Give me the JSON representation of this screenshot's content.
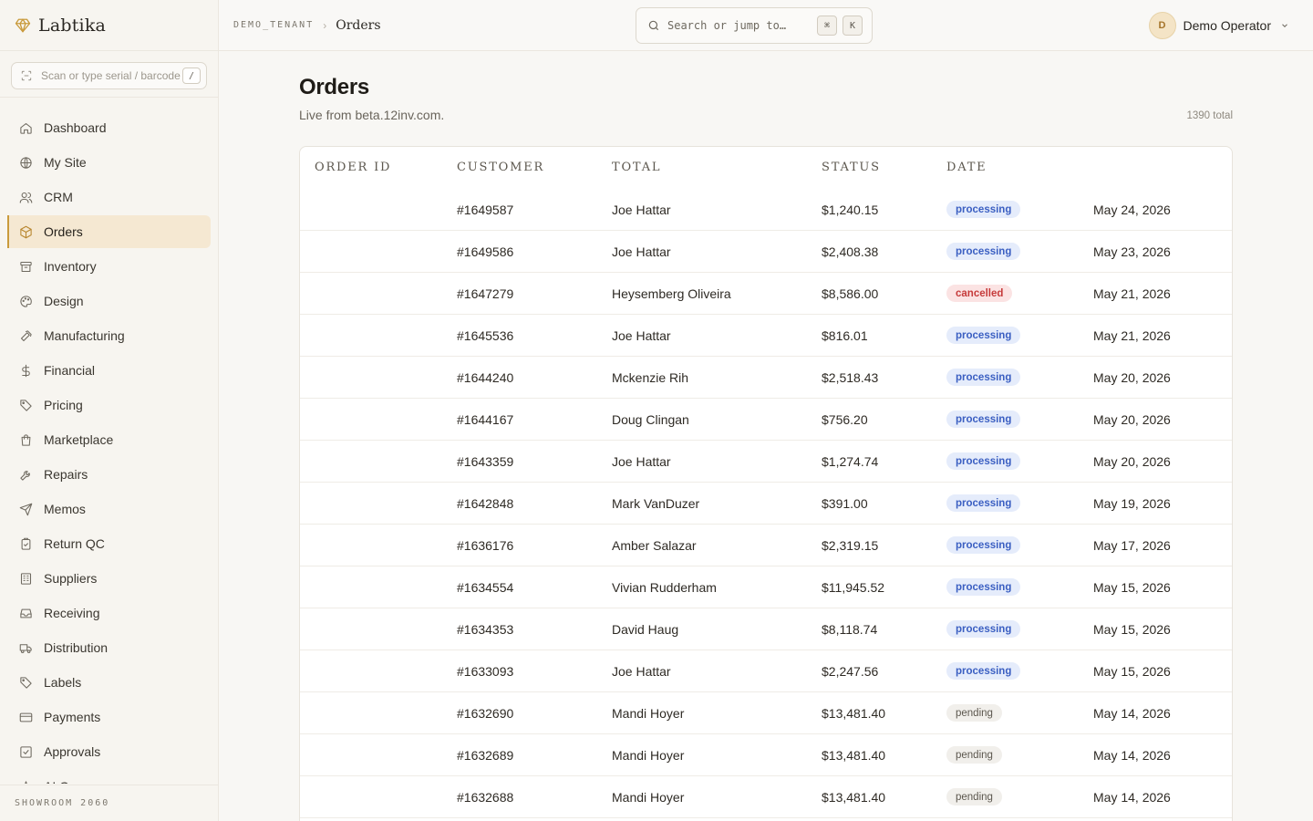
{
  "brand": {
    "name": "Labtika"
  },
  "scan": {
    "placeholder": "Scan or type serial / barcode",
    "shortcut": "/"
  },
  "sidebar": {
    "items": [
      {
        "label": "Dashboard",
        "icon": "home-icon",
        "active": false
      },
      {
        "label": "My Site",
        "icon": "globe-icon",
        "active": false
      },
      {
        "label": "CRM",
        "icon": "users-icon",
        "active": false
      },
      {
        "label": "Orders",
        "icon": "box-icon",
        "active": true
      },
      {
        "label": "Inventory",
        "icon": "archive-icon",
        "active": false
      },
      {
        "label": "Design",
        "icon": "palette-icon",
        "active": false
      },
      {
        "label": "Manufacturing",
        "icon": "hammer-icon",
        "active": false
      },
      {
        "label": "Financial",
        "icon": "dollar-icon",
        "active": false
      },
      {
        "label": "Pricing",
        "icon": "tag-icon",
        "active": false
      },
      {
        "label": "Marketplace",
        "icon": "shopping-bag-icon",
        "active": false
      },
      {
        "label": "Repairs",
        "icon": "wrench-icon",
        "active": false
      },
      {
        "label": "Memos",
        "icon": "send-icon",
        "active": false
      },
      {
        "label": "Return QC",
        "icon": "clipboard-check-icon",
        "active": false
      },
      {
        "label": "Suppliers",
        "icon": "building-icon",
        "active": false
      },
      {
        "label": "Receiving",
        "icon": "inbox-icon",
        "active": false
      },
      {
        "label": "Distribution",
        "icon": "truck-icon",
        "active": false
      },
      {
        "label": "Labels",
        "icon": "tag-icon",
        "active": false
      },
      {
        "label": "Payments",
        "icon": "credit-card-icon",
        "active": false
      },
      {
        "label": "Approvals",
        "icon": "check-square-icon",
        "active": false
      },
      {
        "label": "AI O...",
        "icon": "sparkle-icon",
        "active": false
      }
    ],
    "footer": "SHOWROOM 2060"
  },
  "header": {
    "tenant": "DEMO_TENANT",
    "page": "Orders",
    "search_placeholder": "Search or jump to…",
    "kbd_cmd": "⌘",
    "kbd_k": "K",
    "user_initial": "D",
    "user_name": "Demo Operator"
  },
  "main": {
    "title": "Orders",
    "subtitle": "Live from beta.12inv.com.",
    "total": "1390 total"
  },
  "table": {
    "headers": {
      "order_id": "Order ID",
      "customer": "Customer",
      "total": "Total",
      "status": "Status",
      "date": "Date"
    },
    "rows": [
      {
        "id": "#1649587",
        "customer": "Joe Hattar",
        "total": "$1,240.15",
        "status": "processing",
        "date": "May 24, 2026"
      },
      {
        "id": "#1649586",
        "customer": "Joe Hattar",
        "total": "$2,408.38",
        "status": "processing",
        "date": "May 23, 2026"
      },
      {
        "id": "#1647279",
        "customer": "Heysemberg Oliveira",
        "total": "$8,586.00",
        "status": "cancelled",
        "date": "May 21, 2026"
      },
      {
        "id": "#1645536",
        "customer": "Joe Hattar",
        "total": "$816.01",
        "status": "processing",
        "date": "May 21, 2026"
      },
      {
        "id": "#1644240",
        "customer": "Mckenzie Rih",
        "total": "$2,518.43",
        "status": "processing",
        "date": "May 20, 2026"
      },
      {
        "id": "#1644167",
        "customer": "Doug Clingan",
        "total": "$756.20",
        "status": "processing",
        "date": "May 20, 2026"
      },
      {
        "id": "#1643359",
        "customer": "Joe Hattar",
        "total": "$1,274.74",
        "status": "processing",
        "date": "May 20, 2026"
      },
      {
        "id": "#1642848",
        "customer": "Mark VanDuzer",
        "total": "$391.00",
        "status": "processing",
        "date": "May 19, 2026"
      },
      {
        "id": "#1636176",
        "customer": "Amber Salazar",
        "total": "$2,319.15",
        "status": "processing",
        "date": "May 17, 2026"
      },
      {
        "id": "#1634554",
        "customer": "Vivian Rudderham",
        "total": "$11,945.52",
        "status": "processing",
        "date": "May 15, 2026"
      },
      {
        "id": "#1634353",
        "customer": "David Haug",
        "total": "$8,118.74",
        "status": "processing",
        "date": "May 15, 2026"
      },
      {
        "id": "#1633093",
        "customer": "Joe Hattar",
        "total": "$2,247.56",
        "status": "processing",
        "date": "May 15, 2026"
      },
      {
        "id": "#1632690",
        "customer": "Mandi Hoyer",
        "total": "$13,481.40",
        "status": "pending",
        "date": "May 14, 2026"
      },
      {
        "id": "#1632689",
        "customer": "Mandi Hoyer",
        "total": "$13,481.40",
        "status": "pending",
        "date": "May 14, 2026"
      },
      {
        "id": "#1632688",
        "customer": "Mandi Hoyer",
        "total": "$13,481.40",
        "status": "pending",
        "date": "May 14, 2026"
      }
    ]
  },
  "colors": {
    "accent": "#c99a3c",
    "active_bg": "#f5e8d2",
    "processing": "#3b5fc2",
    "cancelled": "#c63b3b"
  }
}
